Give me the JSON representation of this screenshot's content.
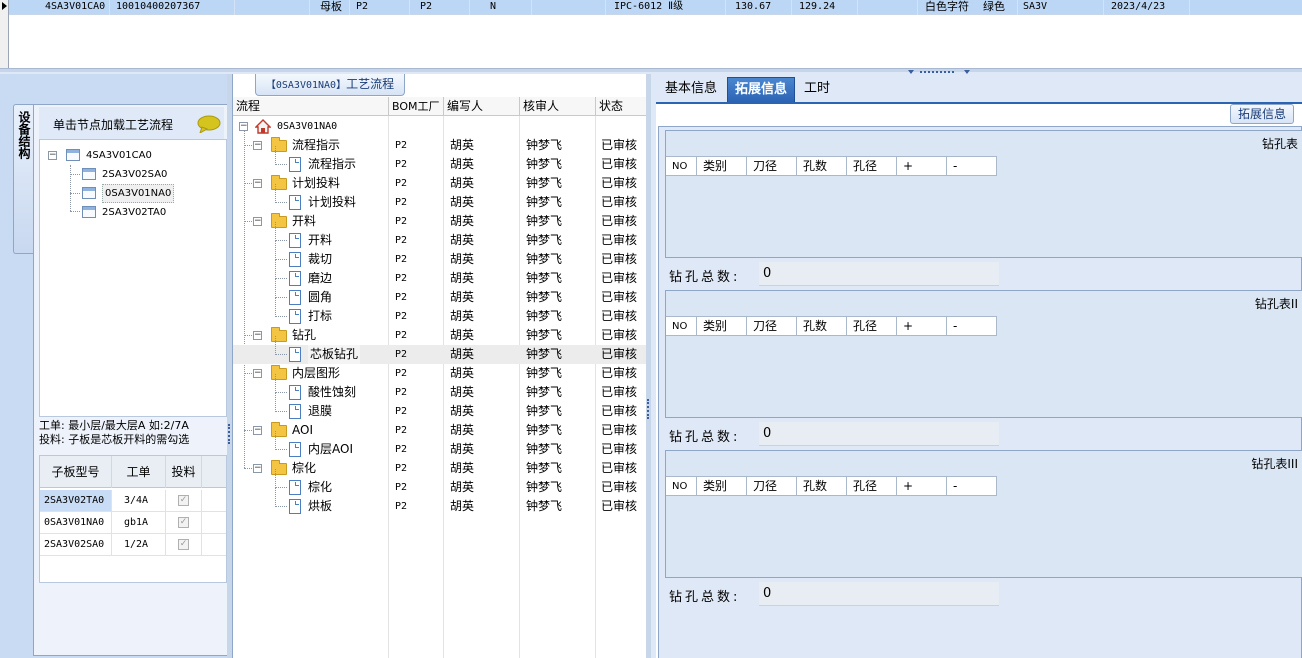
{
  "top_grid": {
    "row": {
      "code": "4SA3V01CA0",
      "number": "10010400207367",
      "type": "母板",
      "factory1": "P2",
      "factory2": "P2",
      "flag": "N",
      "standard": "IPC-6012 Ⅱ级",
      "v1": "130.67",
      "v2": "129.24",
      "char_color": "白色字符",
      "color": "绿色",
      "short": "SA3V",
      "date": "2023/4/23"
    }
  },
  "left": {
    "vertical_tab": "设备结构",
    "load_label": "单击节点加载工艺流程",
    "tree": [
      {
        "label": "4SA3V01CA0"
      },
      {
        "label": "2SA3V02SA0"
      },
      {
        "label": "0SA3V01NA0"
      },
      {
        "label": "2SA3V02TA0"
      }
    ],
    "note_line1": "工单: 最小层/最大层A 如:2/7A",
    "note_line2": "投料: 子板是芯板开料的需勾选",
    "sub_grid": {
      "headers": [
        "子板型号",
        "工单",
        "投料"
      ],
      "rows": [
        {
          "model": "2SA3V02TA0",
          "order": "3/4A",
          "checked": true
        },
        {
          "model": "0SA3V01NA0",
          "order": "gb1A",
          "checked": true
        },
        {
          "model": "2SA3V02SA0",
          "order": "1/2A",
          "checked": true
        }
      ]
    }
  },
  "middle": {
    "caption_code": "【0SA3V01NA0】",
    "caption_text": "工艺流程",
    "headers": [
      "流程",
      "BOM工厂",
      "编写人",
      "核审人",
      "状态"
    ],
    "root": "0SA3V01NA0",
    "rows": [
      {
        "name": "流程指示",
        "level": 1,
        "bom": "P2",
        "author": "胡英",
        "reviewer": "钟梦飞",
        "status": "已审核"
      },
      {
        "name": "流程指示",
        "level": 2,
        "bom": "P2",
        "author": "胡英",
        "reviewer": "钟梦飞",
        "status": "已审核"
      },
      {
        "name": "计划投料",
        "level": 1,
        "bom": "P2",
        "author": "胡英",
        "reviewer": "钟梦飞",
        "status": "已审核"
      },
      {
        "name": "计划投料",
        "level": 2,
        "bom": "P2",
        "author": "胡英",
        "reviewer": "钟梦飞",
        "status": "已审核"
      },
      {
        "name": "开料",
        "level": 1,
        "bom": "P2",
        "author": "胡英",
        "reviewer": "钟梦飞",
        "status": "已审核"
      },
      {
        "name": "开料",
        "level": 2,
        "bom": "P2",
        "author": "胡英",
        "reviewer": "钟梦飞",
        "status": "已审核"
      },
      {
        "name": "裁切",
        "level": 2,
        "bom": "P2",
        "author": "胡英",
        "reviewer": "钟梦飞",
        "status": "已审核"
      },
      {
        "name": "磨边",
        "level": 2,
        "bom": "P2",
        "author": "胡英",
        "reviewer": "钟梦飞",
        "status": "已审核"
      },
      {
        "name": "圆角",
        "level": 2,
        "bom": "P2",
        "author": "胡英",
        "reviewer": "钟梦飞",
        "status": "已审核"
      },
      {
        "name": "打标",
        "level": 2,
        "bom": "P2",
        "author": "胡英",
        "reviewer": "钟梦飞",
        "status": "已审核"
      },
      {
        "name": "钻孔",
        "level": 1,
        "bom": "P2",
        "author": "胡英",
        "reviewer": "钟梦飞",
        "status": "已审核"
      },
      {
        "name": "芯板钻孔",
        "level": 2,
        "bom": "P2",
        "author": "胡英",
        "reviewer": "钟梦飞",
        "status": "已审核",
        "selected": true
      },
      {
        "name": "内层图形",
        "level": 1,
        "bom": "P2",
        "author": "胡英",
        "reviewer": "钟梦飞",
        "status": "已审核"
      },
      {
        "name": "酸性蚀刻",
        "level": 2,
        "bom": "P2",
        "author": "胡英",
        "reviewer": "钟梦飞",
        "status": "已审核"
      },
      {
        "name": "退膜",
        "level": 2,
        "bom": "P2",
        "author": "胡英",
        "reviewer": "钟梦飞",
        "status": "已审核"
      },
      {
        "name": "AOI",
        "level": 1,
        "bom": "P2",
        "author": "胡英",
        "reviewer": "钟梦飞",
        "status": "已审核"
      },
      {
        "name": "内层AOI",
        "level": 2,
        "bom": "P2",
        "author": "胡英",
        "reviewer": "钟梦飞",
        "status": "已审核"
      },
      {
        "name": "棕化",
        "level": 1,
        "bom": "P2",
        "author": "胡英",
        "reviewer": "钟梦飞",
        "status": "已审核"
      },
      {
        "name": "棕化",
        "level": 2,
        "bom": "P2",
        "author": "胡英",
        "reviewer": "钟梦飞",
        "status": "已审核"
      },
      {
        "name": "烘板",
        "level": 2,
        "bom": "P2",
        "author": "胡英",
        "reviewer": "钟梦飞",
        "status": "已审核"
      }
    ]
  },
  "right": {
    "tabs": [
      "基本信息",
      "拓展信息",
      "工时"
    ],
    "active_tab": "拓展信息",
    "ext_caption": "拓展信息",
    "drill_headers": [
      "NO",
      "类别",
      "刀径",
      "孔数",
      "孔径",
      "+",
      "-"
    ],
    "total_label": "钻孔总数:",
    "tables": [
      {
        "title": "钻孔表",
        "total": "0"
      },
      {
        "title": "钻孔表II",
        "total": "0"
      },
      {
        "title": "钻孔表III",
        "total": "0"
      }
    ]
  },
  "colors": {
    "accent": "#2c64b4",
    "selection_row": "#bcd6f5",
    "panel_bg": "#dfe8f6"
  }
}
